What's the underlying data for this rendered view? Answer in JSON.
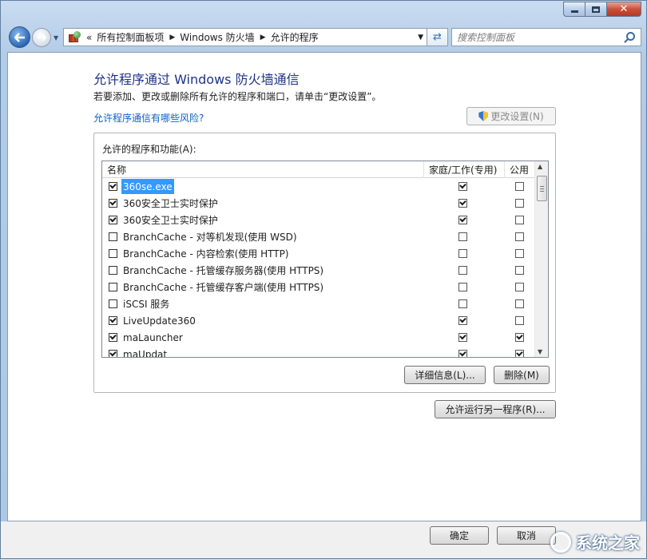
{
  "navigation": {
    "breadcrumb_prefix": "«",
    "breadcrumbs": [
      "所有控制面板项",
      "Windows 防火墙",
      "允许的程序"
    ],
    "search_placeholder": "搜索控制面板"
  },
  "main": {
    "title": "允许程序通过 Windows 防火墙通信",
    "subtitle": "若要添加、更改或删除所有允许的程序和端口，请单击“更改设置”。",
    "risk_link": "允许程序通信有哪些风险?",
    "change_settings_label": "更改设置(N)",
    "group_label": "允许的程序和功能(A):",
    "columns": [
      "名称",
      "家庭/工作(专用)",
      "公用"
    ],
    "rows": [
      {
        "name": "360se.exe",
        "enabled": true,
        "private": true,
        "public": false,
        "selected": true
      },
      {
        "name": "360安全卫士实时保护",
        "enabled": true,
        "private": true,
        "public": false
      },
      {
        "name": "360安全卫士实时保护",
        "enabled": true,
        "private": true,
        "public": false
      },
      {
        "name": "BranchCache - 对等机发现(使用 WSD)",
        "enabled": false,
        "private": false,
        "public": false
      },
      {
        "name": "BranchCache - 内容检索(使用 HTTP)",
        "enabled": false,
        "private": false,
        "public": false
      },
      {
        "name": "BranchCache - 托管缓存服务器(使用 HTTPS)",
        "enabled": false,
        "private": false,
        "public": false
      },
      {
        "name": "BranchCache - 托管缓存客户端(使用 HTTPS)",
        "enabled": false,
        "private": false,
        "public": false
      },
      {
        "name": "iSCSI 服务",
        "enabled": false,
        "private": false,
        "public": false
      },
      {
        "name": "LiveUpdate360",
        "enabled": true,
        "private": true,
        "public": false
      },
      {
        "name": "maLauncher",
        "enabled": true,
        "private": true,
        "public": true
      },
      {
        "name": "maUpdat",
        "enabled": true,
        "private": true,
        "public": true
      }
    ],
    "details_label": "详细信息(L)...",
    "remove_label": "删除(M)",
    "allow_another_label": "允许运行另一程序(R)..."
  },
  "footer": {
    "ok_label": "确定",
    "cancel_label": "取消"
  },
  "watermark": {
    "text": "系统之家"
  }
}
